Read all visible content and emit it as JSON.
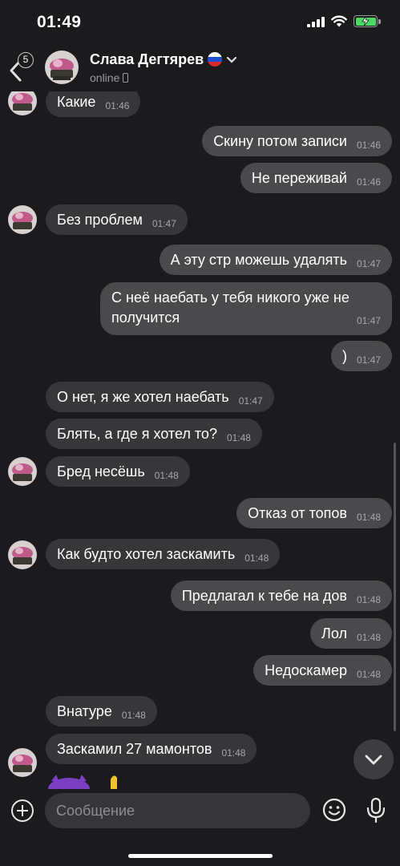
{
  "status_bar": {
    "time": "01:49"
  },
  "header": {
    "back_badge": "5",
    "contact_name": "Слава Дегтярев",
    "status": "online"
  },
  "messages": [
    {
      "dir": "in",
      "text": "Какие",
      "time": "01:46"
    },
    {
      "dir": "out",
      "text": "Скину потом записи",
      "time": "01:46"
    },
    {
      "dir": "out",
      "text": "Не переживай",
      "time": "01:46"
    },
    {
      "dir": "in",
      "text": "Без проблем",
      "time": "01:47"
    },
    {
      "dir": "out",
      "text": "А эту стр можешь удалять",
      "time": "01:47"
    },
    {
      "dir": "out",
      "text": "С неё наебать у тебя никого уже не получится",
      "time": "01:47"
    },
    {
      "dir": "out",
      "text": ")",
      "time": "01:47"
    },
    {
      "dir": "in",
      "text": "О нет, я же хотел наебать",
      "time": "01:47"
    },
    {
      "dir": "in",
      "text": "Блять, а где я хотел то?",
      "time": "01:48"
    },
    {
      "dir": "in",
      "text": "Бред несёшь",
      "time": "01:48"
    },
    {
      "dir": "out",
      "text": "Отказ от топов",
      "time": "01:48"
    },
    {
      "dir": "in",
      "text": "Как будто хотел заскамить",
      "time": "01:48"
    },
    {
      "dir": "out",
      "text": "Предлагал к тебе на дов",
      "time": "01:48"
    },
    {
      "dir": "out",
      "text": "Лол",
      "time": "01:48"
    },
    {
      "dir": "out",
      "text": "Недоскамер",
      "time": "01:48"
    },
    {
      "dir": "in",
      "text": "Внатуре",
      "time": "01:48"
    },
    {
      "dir": "in",
      "text": "Заскамил 27 мамонтов",
      "time": "01:48"
    }
  ],
  "input": {
    "placeholder": "Сообщение"
  },
  "colors": {
    "background": "#1b1b1d",
    "bubble_in": "#373739",
    "bubble_out": "#4a4a4c",
    "battery_green": "#4cd964"
  }
}
